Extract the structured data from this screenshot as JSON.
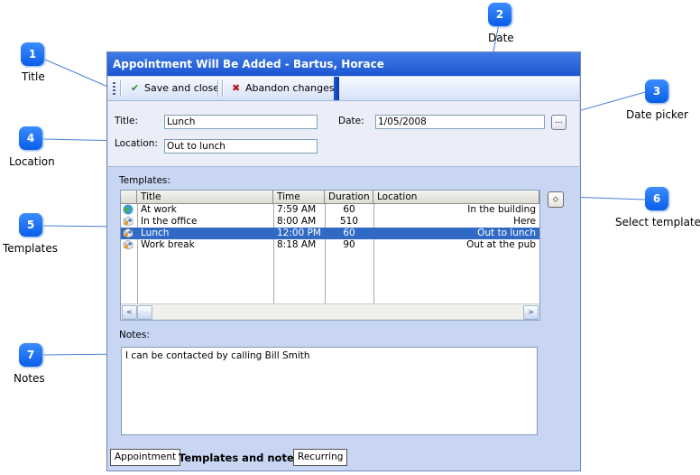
{
  "window": {
    "title": "Appointment Will Be Added - Bartus, Horace"
  },
  "toolbar": {
    "save_label": "Save and close",
    "abandon_label": "Abandon changes"
  },
  "form": {
    "title_label": "Title:",
    "title_value": "Lunch",
    "date_label": "Date:",
    "date_value": "1/05/2008",
    "date_picker_label": "...",
    "location_label": "Location:",
    "location_value": "Out to lunch"
  },
  "templates": {
    "label": "Templates:",
    "columns": [
      "Title",
      "Time",
      "Duration",
      "Location"
    ],
    "rows": [
      {
        "title": "At work",
        "time": "7:59 AM",
        "duration": "60",
        "location": "In the building",
        "icon": "globe-icon"
      },
      {
        "title": "In the office",
        "time": "8:00 AM",
        "duration": "510",
        "location": "Here",
        "icon": "template-icon"
      },
      {
        "title": "Lunch",
        "time": "12:00 PM",
        "duration": "60",
        "location": "Out to lunch",
        "icon": "template-icon"
      },
      {
        "title": "Work break",
        "time": "8:18 AM",
        "duration": "90",
        "location": "Out at the pub",
        "icon": "template-icon"
      }
    ],
    "selected_index": 2,
    "scroll_left": "<",
    "scroll_right": ">"
  },
  "notes": {
    "label": "Notes:",
    "value": "I can be contacted by calling Bill Smith"
  },
  "tabs": [
    {
      "label": "Appointment"
    },
    {
      "label": "Templates and notes"
    },
    {
      "label": "Recurring"
    }
  ],
  "callouts": [
    {
      "num": "1",
      "label": "Title"
    },
    {
      "num": "2",
      "label": "Date"
    },
    {
      "num": "3",
      "label": "Date picker"
    },
    {
      "num": "4",
      "label": "Location"
    },
    {
      "num": "5",
      "label": "Templates"
    },
    {
      "num": "6",
      "label": "Select template"
    },
    {
      "num": "7",
      "label": "Notes"
    }
  ],
  "colors": {
    "callout": "#1566f0",
    "title_bar": "#2a62dc",
    "selection": "#316ac5",
    "panel": "#c8d6f3"
  }
}
